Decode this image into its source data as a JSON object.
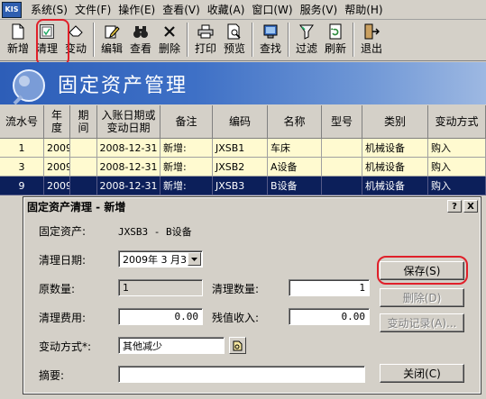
{
  "app": {
    "logo_text": "KIS"
  },
  "menu": [
    {
      "label": "系统(S)"
    },
    {
      "label": "文件(F)"
    },
    {
      "label": "操作(E)"
    },
    {
      "label": "查看(V)"
    },
    {
      "label": "收藏(A)"
    },
    {
      "label": "窗口(W)"
    },
    {
      "label": "服务(V)"
    },
    {
      "label": "帮助(H)"
    }
  ],
  "toolbar": [
    {
      "label": "新增",
      "icon": "new-icon"
    },
    {
      "label": "清理",
      "icon": "clean-icon"
    },
    {
      "label": "变动",
      "icon": "change-icon"
    },
    {
      "label": "编辑",
      "icon": "edit-icon"
    },
    {
      "label": "查看",
      "icon": "binoculars-icon"
    },
    {
      "label": "删除",
      "icon": "delete-icon"
    },
    {
      "label": "打印",
      "icon": "print-icon"
    },
    {
      "label": "预览",
      "icon": "preview-icon"
    },
    {
      "label": "查找",
      "icon": "find-icon"
    },
    {
      "label": "过滤",
      "icon": "filter-icon"
    },
    {
      "label": "刷新",
      "icon": "refresh-icon"
    },
    {
      "label": "退出",
      "icon": "exit-icon"
    }
  ],
  "banner": {
    "title": "固定资产管理"
  },
  "grid": {
    "headers": [
      "流水号",
      "年度",
      "期间",
      "入账日期或变动日期",
      "备注",
      "编码",
      "名称",
      "型号",
      "类别",
      "变动方式"
    ],
    "rows": [
      {
        "no": "1",
        "year": "2009",
        "period": "",
        "date": "2008-12-31",
        "note": "新增:",
        "code": "JXSB1",
        "name": "车床",
        "model": "",
        "category": "机械设备",
        "way": "购入"
      },
      {
        "no": "3",
        "year": "2009",
        "period": "",
        "date": "2008-12-31",
        "note": "新增:",
        "code": "JXSB2",
        "name": "A设备",
        "model": "",
        "category": "机械设备",
        "way": "购入"
      },
      {
        "no": "9",
        "year": "2009",
        "period": "",
        "date": "2008-12-31",
        "note": "新增:",
        "code": "JXSB3",
        "name": "B设备",
        "model": "",
        "category": "机械设备",
        "way": "购入"
      }
    ]
  },
  "dialog": {
    "title": "固定资产清理 - 新增",
    "help_btn": "?",
    "close_btn": "X",
    "asset_label": "固定资产:",
    "asset_value": "JXSB3 - B设备",
    "date_label": "清理日期:",
    "date_value": "2009年 3 月31",
    "orig_qty_label": "原数量:",
    "orig_qty_value": "1",
    "clean_qty_label": "清理数量:",
    "clean_qty_value": "1",
    "fee_label": "清理费用:",
    "fee_value": "0.00",
    "residual_label": "残值收入:",
    "residual_value": "0.00",
    "way_label": "变动方式*:",
    "way_value": "其他减少",
    "summary_label": "摘要:",
    "summary_value": "",
    "save_button": "保存(S)",
    "delete_button": "删除(D)",
    "history_button": "变动记录(A)...",
    "close_button": "关闭(C)"
  }
}
